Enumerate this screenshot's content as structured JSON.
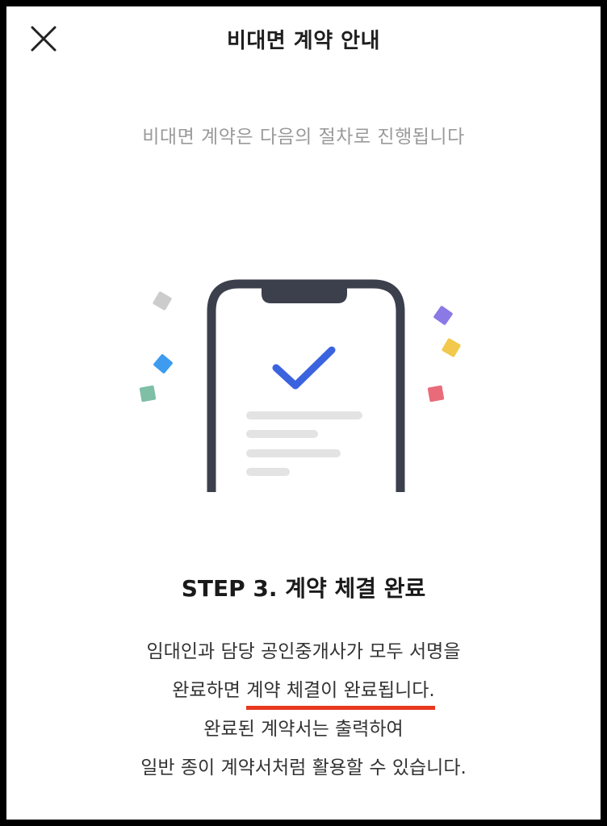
{
  "header": {
    "title": "비대면 계약 안내",
    "close_icon": "close-icon"
  },
  "subtitle": "비대면 계약은 다음의 절차로 진행됩니다",
  "illustration": {
    "icon": "phone-check-illustration",
    "check_color": "#3b63e0",
    "frame_color": "#3c3f4c",
    "confetti_colors": [
      "#cccccc",
      "#3d9bf0",
      "#7ebfa6",
      "#8b79e6",
      "#f2c94c",
      "#e96b7a"
    ]
  },
  "step": {
    "title": "STEP 3. 계약 체결 완료"
  },
  "description": {
    "line1": "임대인과 담당 공인중개사가 모두 서명을",
    "line2_prefix": "완료하면 ",
    "line2_highlight": "계약 체결이 완료됩니다.",
    "line3": "완료된 계약서는 출력하여",
    "line4": "일반 종이 계약서처럼 활용할 수 있습니다.",
    "highlight_color": "#e8391f"
  }
}
